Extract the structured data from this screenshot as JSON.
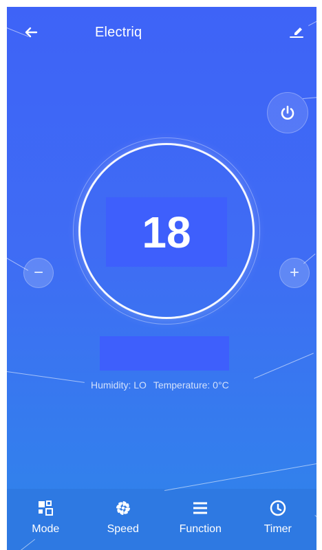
{
  "header": {
    "title": "Electriq"
  },
  "thermostat": {
    "temperature": "18"
  },
  "controls": {
    "minus": "−",
    "plus": "+"
  },
  "status": {
    "humidity": "Humidity: LO",
    "temperature": "Temperature: 0°C"
  },
  "toolbar": {
    "items": [
      {
        "label": "Mode"
      },
      {
        "label": "Speed"
      },
      {
        "label": "Function"
      },
      {
        "label": "Timer"
      }
    ]
  }
}
